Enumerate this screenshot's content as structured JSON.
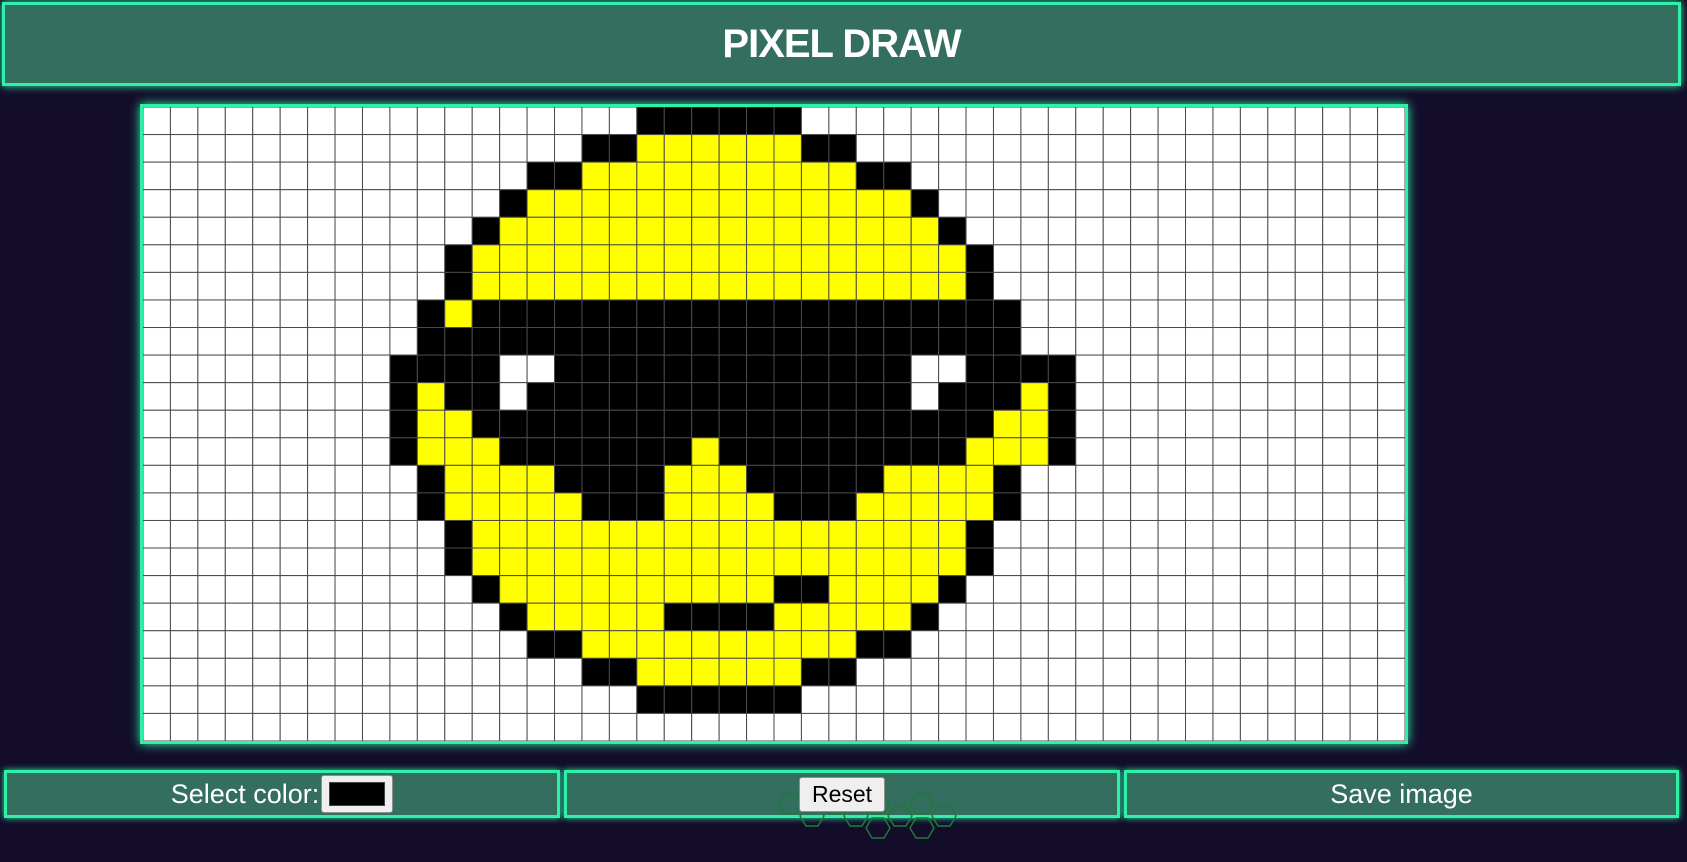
{
  "header": {
    "title": "PIXEL DRAW"
  },
  "canvas": {
    "columns": 46,
    "rows": 23,
    "background": "#ffffff",
    "grid_color": "#4a4a4a",
    "palette": {
      "B": "#000000",
      "Y": "#ffff00",
      "W": "#ffffff"
    },
    "pixels": [
      "..................BBBBBB......................",
      "................BBYYYYYYBB....................",
      "..............BBYYYYYYYYYYBB..................",
      ".............BYYYYYYYYYYYYYYB.................",
      "............BYYYYYYYYYYYYYYYYB................",
      "...........BYYYYYYYYYYYYYYYYYYB...............",
      "...........BYYYYYYYYYYYYYYYYYYB...............",
      "..........BYBBBBBBBBBBBBBBBBBBBB..............",
      "..........BBBBBBBBBBBBBBBBBBBBBB..............",
      ".........BBBBWWBBBBBBBBBBBBBWWBBBB............",
      ".........BYBBWBBBBBBBBBBBBBBWBBBYB............",
      ".........BYYBBBBBBBBBBBBBBBBBBBYYB............",
      ".........BYYYBBBBBBBYBBBBBBBBBYYYB............",
      "..........BYYYYBBBBYYYBBBBBYYYYB..............",
      "..........BYYYYYBBBYYYYBBBYYYYYB..............",
      "...........BYYYYYYYYYYYYYYYYYYB...............",
      "...........BYYYYYYYYYYYYYYYYYYB...............",
      "............BYYYYYYYYYYBBYYYYB................",
      ".............BYYYYYBBBBYYYYYB.................",
      "..............BBYYYYYYYYYYBB..................",
      "................BBYYYYYYBB....................",
      "..................BBBBBB......................",
      ".............................................."
    ]
  },
  "controls": {
    "color_label": "Select color:",
    "selected_color": "#000000",
    "reset_label": "Reset",
    "save_label": "Save image"
  }
}
